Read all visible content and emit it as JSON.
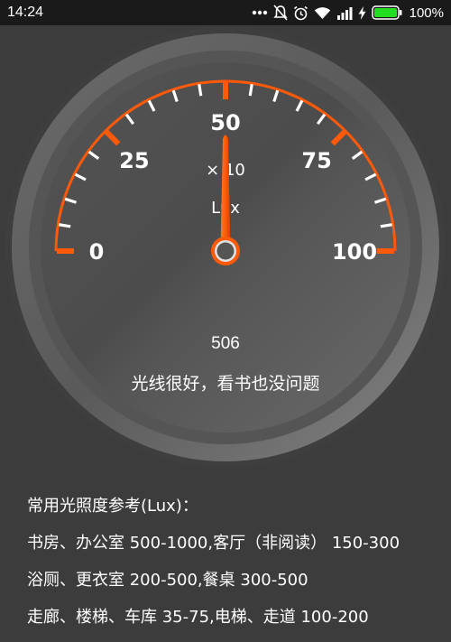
{
  "status_bar": {
    "time": "14:24",
    "icons": [
      "more-dots-icon",
      "mute-icon",
      "alarm-icon",
      "wifi-icon",
      "signal-icon",
      "charging-icon",
      "battery-icon"
    ],
    "battery_percent": "100%"
  },
  "gauge": {
    "labels": [
      "0",
      "25",
      "50",
      "75",
      "100"
    ],
    "multiplier": "× 10",
    "unit": "Lux",
    "needle_value": 50,
    "scale_min": 0,
    "scale_max": 100,
    "accent_color": "#ff5a0a"
  },
  "reading": {
    "value": "506",
    "status": "光线很好，看书也没问题"
  },
  "reference": {
    "title": "常用光照度参考(Lux)：",
    "lines": [
      "书房、办公室 500-1000,客厅（非阅读） 150-300",
      "浴厕、更衣室 200-500,餐桌 300-500",
      "走廊、楼梯、车库 35-75,电梯、走道 100-200"
    ]
  }
}
